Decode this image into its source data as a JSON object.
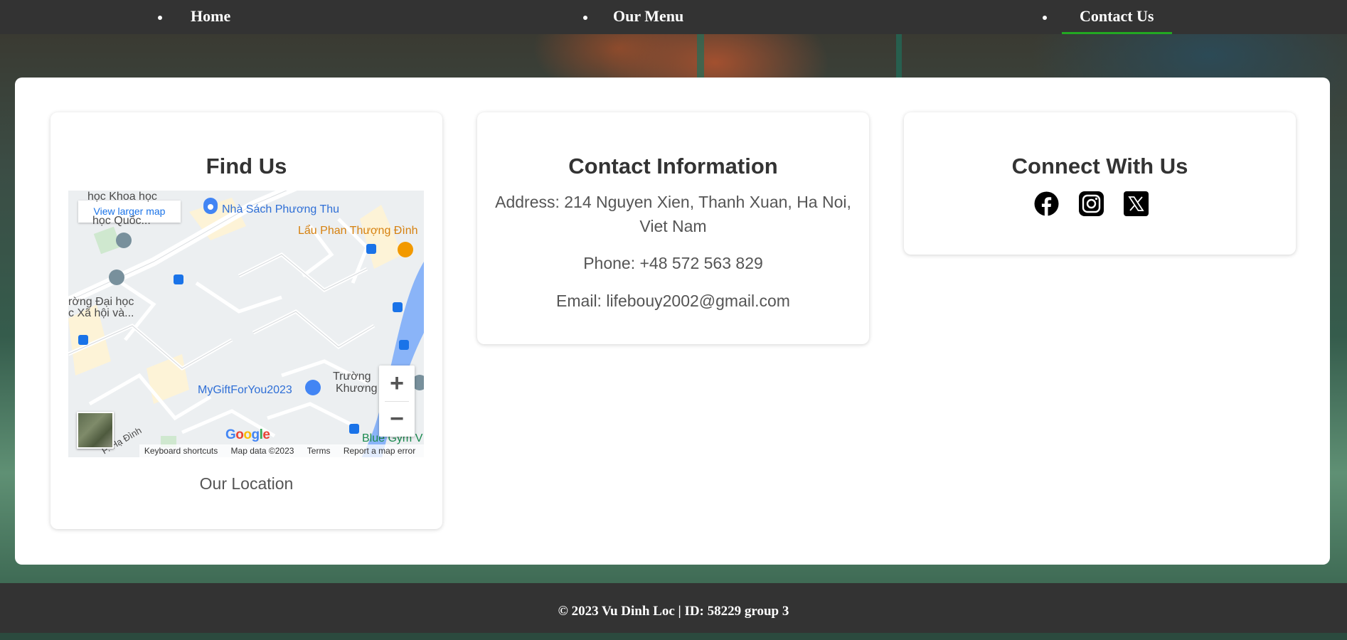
{
  "nav": {
    "items": [
      {
        "label": "Home",
        "active": false
      },
      {
        "label": "Our Menu",
        "active": false
      },
      {
        "label": "Contact Us",
        "active": true
      }
    ],
    "active_color": "#22a822"
  },
  "find": {
    "title": "Find Us",
    "caption": "Our Location",
    "map": {
      "view_larger": "View larger map",
      "labels": {
        "nha_sach": "Nhà Sách Phương Thu",
        "lau_phan": "Lẩu Phan Thượng Đình",
        "hoc_khoa": "học Khoa học",
        "hoc_quoc": "học Quốc...",
        "truong_dai_hoc": "rờng Đại học",
        "xa_hoi": "c Xã hội và...",
        "mygift": "MyGiftForYou2023",
        "truong": "Trường",
        "khuong": "Khương",
        "blue_gym": "Blue Gym V",
        "p_ha_dinh": "P. Hạ Đình"
      },
      "zoom_in": "+",
      "zoom_out": "−",
      "google": "Google",
      "footer": {
        "shortcuts": "Keyboard shortcuts",
        "data": "Map data ©2023",
        "terms": "Terms",
        "report": "Report a map error"
      }
    }
  },
  "contact": {
    "title": "Contact Information",
    "address": "Address: 214 Nguyen Xien, Thanh Xuan, Ha Noi, Viet Nam",
    "phone": "Phone: +48 572 563 829",
    "email": "Email: lifebouy2002@gmail.com"
  },
  "connect": {
    "title": "Connect With Us",
    "icons": [
      "facebook-icon",
      "instagram-icon",
      "x-icon"
    ]
  },
  "footer": {
    "text": "© 2023 Vu Dinh Loc | ID: 58229 group 3"
  }
}
